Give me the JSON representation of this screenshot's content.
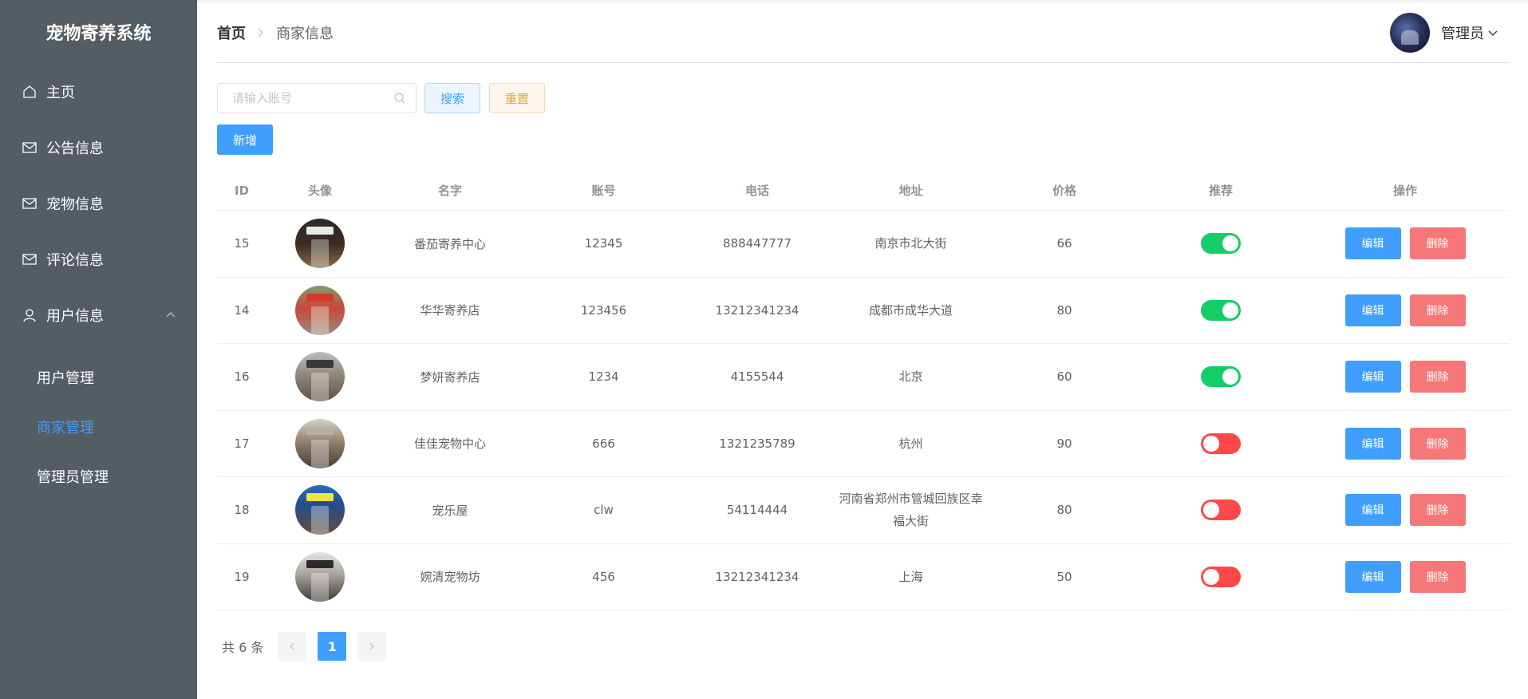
{
  "app": {
    "title": "宠物寄养系统"
  },
  "sidebar": {
    "items": [
      {
        "label": "主页",
        "icon": "home-icon"
      },
      {
        "label": "公告信息",
        "icon": "envelope-icon"
      },
      {
        "label": "宠物信息",
        "icon": "envelope-icon"
      },
      {
        "label": "评论信息",
        "icon": "envelope-icon"
      },
      {
        "label": "用户信息",
        "icon": "user-icon"
      }
    ],
    "submenu": [
      {
        "label": "用户管理"
      },
      {
        "label": "商家管理"
      },
      {
        "label": "管理员管理"
      }
    ],
    "active_sub": "商家管理"
  },
  "header": {
    "breadcrumb_home": "首页",
    "breadcrumb_current": "商家信息",
    "user_name": "管理员"
  },
  "search": {
    "placeholder": "请输入账号",
    "search_label": "搜索",
    "reset_label": "重置"
  },
  "toolbar": {
    "add_label": "新增"
  },
  "table": {
    "headers": [
      "ID",
      "头像",
      "名字",
      "账号",
      "电话",
      "地址",
      "价格",
      "推荐",
      "操作"
    ],
    "edit_label": "编辑",
    "delete_label": "删除",
    "rows": [
      {
        "id": "15",
        "name": "番茄寄养中心",
        "account": "12345",
        "phone": "888447777",
        "address": "南京市北大街",
        "price": "66",
        "recommend": true
      },
      {
        "id": "14",
        "name": "华华寄养店",
        "account": "123456",
        "phone": "13212341234",
        "address": "成都市成华大道",
        "price": "80",
        "recommend": true
      },
      {
        "id": "16",
        "name": "梦妍寄养店",
        "account": "1234",
        "phone": "4155544",
        "address": "北京",
        "price": "60",
        "recommend": true
      },
      {
        "id": "17",
        "name": "佳佳宠物中心",
        "account": "666",
        "phone": "1321235789",
        "address": "杭州",
        "price": "90",
        "recommend": false
      },
      {
        "id": "18",
        "name": "宠乐屋",
        "account": "clw",
        "phone": "54114444",
        "address": "河南省郑州市管城回族区幸福大街",
        "price": "80",
        "recommend": false
      },
      {
        "id": "19",
        "name": "婉清宠物坊",
        "account": "456",
        "phone": "13212341234",
        "address": "上海",
        "price": "50",
        "recommend": false
      }
    ]
  },
  "pagination": {
    "total_text": "共 6 条",
    "current_page": "1"
  },
  "colors": {
    "sidebar_bg": "#545c64",
    "primary": "#409eff",
    "danger": "#f56c6c",
    "switch_on": "#13ce66",
    "switch_off": "#ff4949"
  }
}
